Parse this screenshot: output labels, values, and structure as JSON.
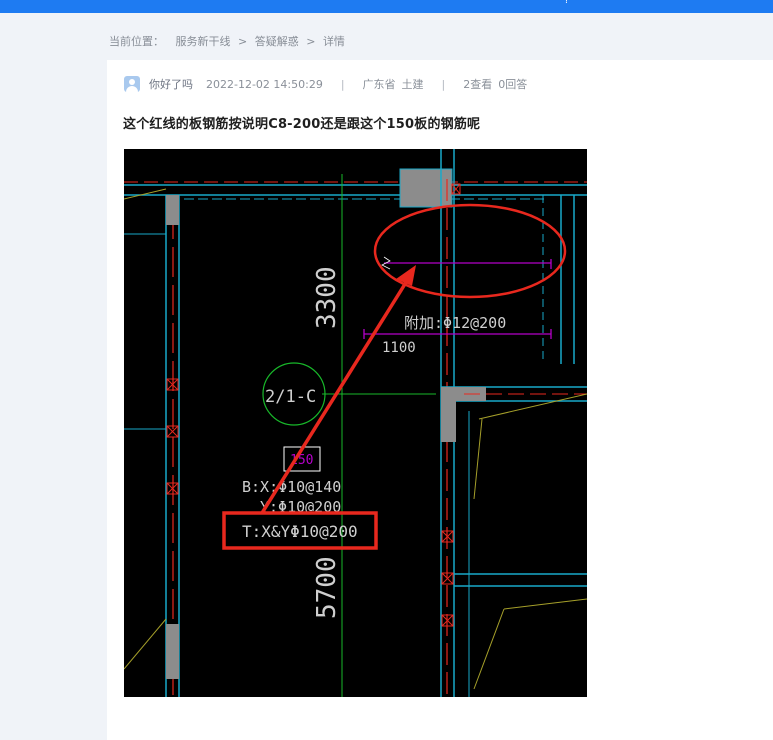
{
  "topbar": {
    "glyph": "?"
  },
  "breadcrumb": {
    "prefix": "当前位置：",
    "items": [
      "服务新干线",
      "答疑解惑",
      "详情"
    ],
    "separator": ">"
  },
  "question": {
    "user": "你好了吗",
    "date": "2022-12-02 14:50:29",
    "region": "广东省",
    "category": "土建",
    "views": "2查看",
    "answers": "0回答",
    "title": "这个红线的板钢筋按说明C8-200还是跟这个150板的钢筋呢"
  },
  "drawing": {
    "dim_top": "3300",
    "dim_bottom": "5700",
    "axis_label": "2/1-C",
    "slab_thickness": "150",
    "bottom_x": "B:X:Φ10@140",
    "bottom_y": "Y:Φ10@200",
    "top_rebar": "T:X&YΦ10@200",
    "add_rebar": "附加:Φ12@200",
    "add_length": "1100"
  },
  "colors": {
    "topbar": "#1e7bf2",
    "annotation_red": "#e8281e",
    "cad_cyan": "#19a9c9",
    "cad_green": "#18b82a",
    "cad_magenta": "#b400c8",
    "cad_yellow": "#a6a02a"
  }
}
